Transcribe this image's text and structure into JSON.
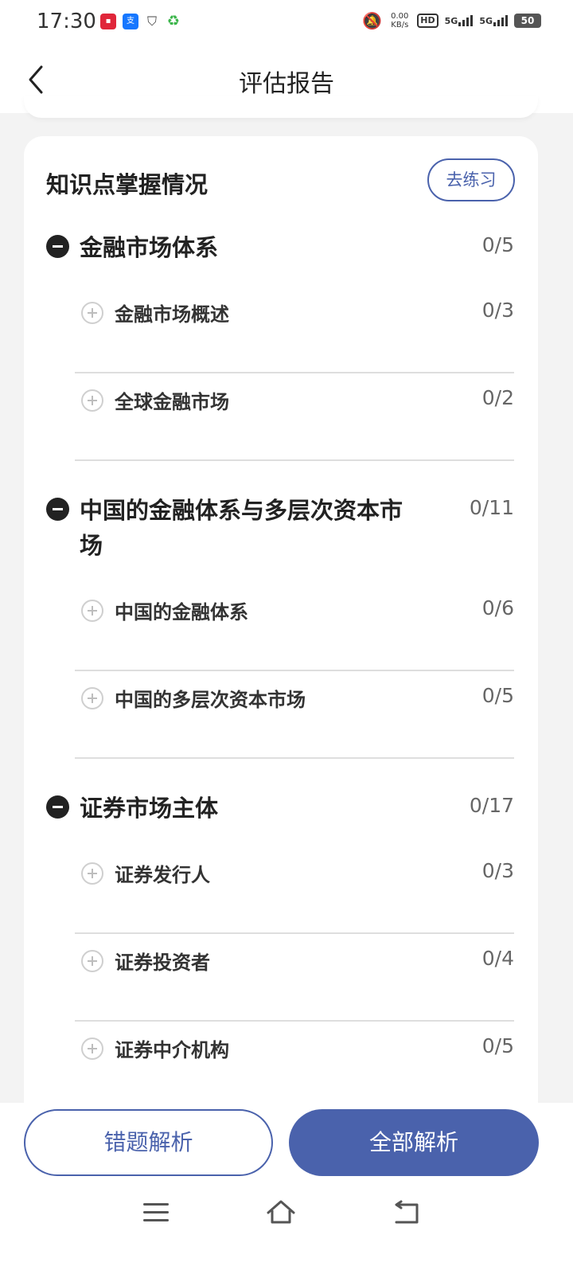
{
  "status_bar": {
    "time": "17:30",
    "net_speed_value": "0.00",
    "net_speed_unit": "KB/s",
    "hd": "HD",
    "signal_1": "5G",
    "signal_2": "5G",
    "battery": "50",
    "icons": [
      "app-red-icon",
      "alipay-icon",
      "shield-icon",
      "recycle-icon",
      "bell-off-icon"
    ]
  },
  "header": {
    "title": "评估报告"
  },
  "card": {
    "title": "知识点掌握情况",
    "practice_label": "去练习",
    "groups": [
      {
        "title": "金融市场体系",
        "score": "0/5",
        "items": [
          {
            "title": "金融市场概述",
            "score": "0/3"
          },
          {
            "title": "全球金融市场",
            "score": "0/2"
          }
        ]
      },
      {
        "title": "中国的金融体系与多层次资本市场",
        "score": "0/11",
        "items": [
          {
            "title": "中国的金融体系",
            "score": "0/6"
          },
          {
            "title": "中国的多层次资本市场",
            "score": "0/5"
          }
        ]
      },
      {
        "title": "证券市场主体",
        "score": "0/17",
        "items": [
          {
            "title": "证券发行人",
            "score": "0/3"
          },
          {
            "title": "证券投资者",
            "score": "0/4"
          },
          {
            "title": "证券中介机构",
            "score": "0/5"
          }
        ]
      }
    ]
  },
  "bottom": {
    "wrong_label": "错题解析",
    "all_label": "全部解析"
  },
  "colors": {
    "accent": "#4a62ac",
    "background": "#f3f3f3"
  }
}
